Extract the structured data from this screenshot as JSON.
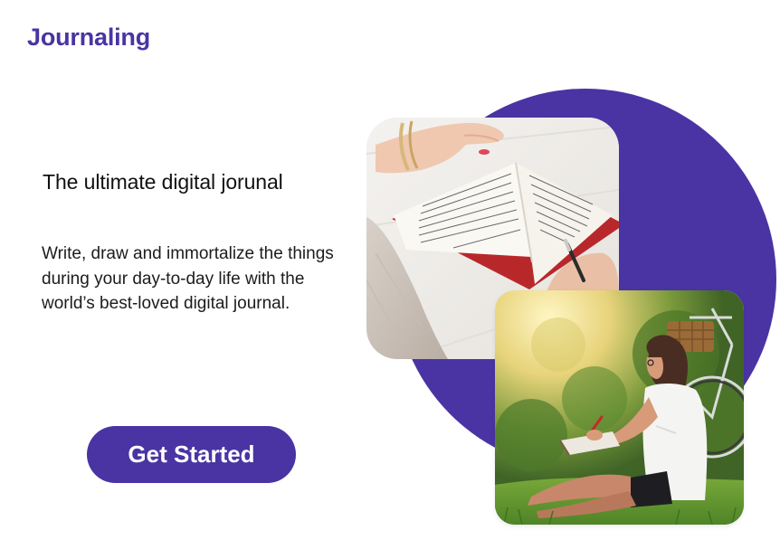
{
  "header": {
    "brand": "Journaling"
  },
  "hero": {
    "headline": "The ultimate digital jorunal",
    "description": "Write, draw and immortalize the things during your day-to-day life with the world’s best-loved digital journal.",
    "cta_label": "Get Started"
  },
  "colors": {
    "accent": "#4a34a3",
    "background": "#ffffff",
    "text": "#111111"
  },
  "images": [
    {
      "name": "journal-writing-photo",
      "subject": "hands writing in an open notebook"
    },
    {
      "name": "woman-in-park-photo",
      "subject": "woman sitting on grass writing in a notebook next to a bicycle"
    }
  ]
}
